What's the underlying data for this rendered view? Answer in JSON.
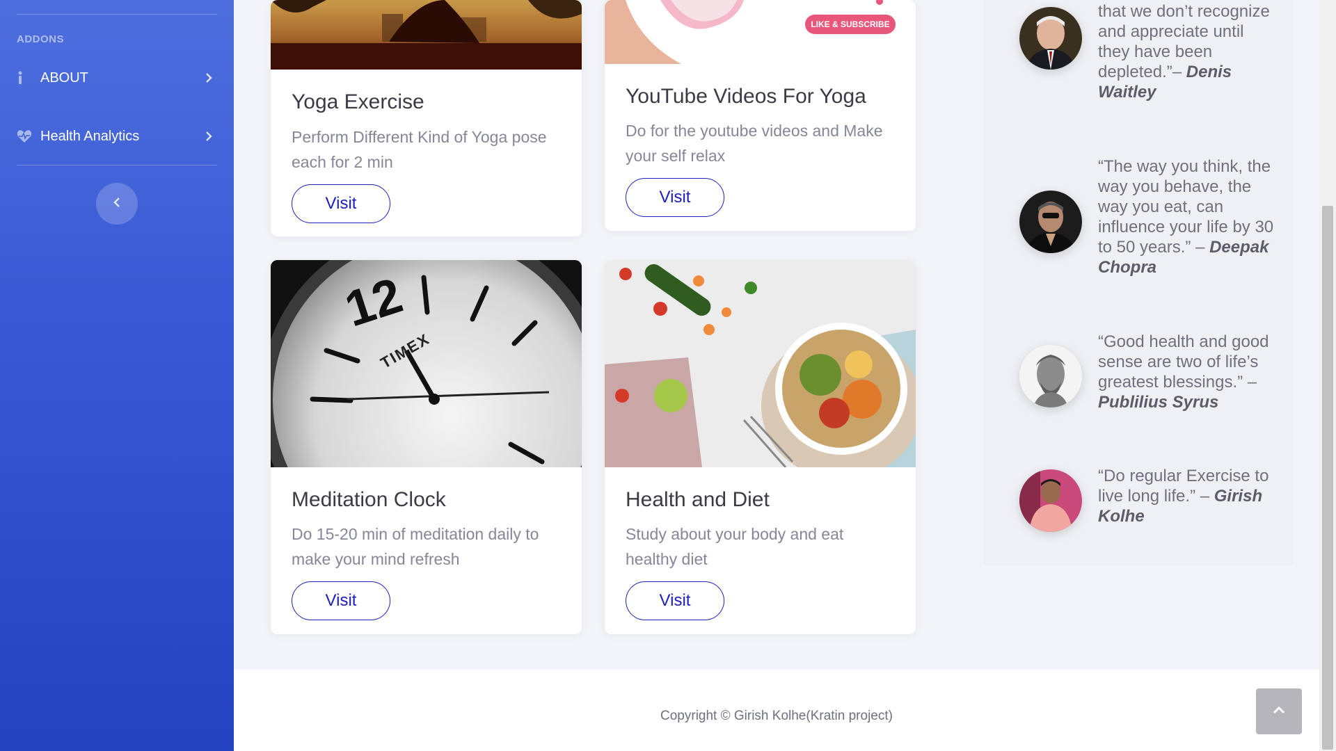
{
  "sidebar": {
    "heading": "ADDONS",
    "items": [
      {
        "label": "ABOUT",
        "icon": "info-icon"
      },
      {
        "label": "Health Analytics",
        "icon": "heartbeat-icon"
      }
    ],
    "toggle_icon": "chevron-left-icon"
  },
  "cards": [
    {
      "title": "Yoga Exercise",
      "text": "Perform Different Kind of Yoga pose each for 2 min",
      "button": "Visit"
    },
    {
      "title": "YouTube Videos For Yoga",
      "text": "Do for the youtube videos and Make your self relax",
      "button": "Visit",
      "badge": "LIKE & SUBSCRIBE"
    },
    {
      "title": "Meditation Clock",
      "text": "Do 15-20 min of meditation daily to make your mind refresh",
      "button": "Visit",
      "clock_brand": "TIMEX",
      "clock_number": "12"
    },
    {
      "title": "Health and Diet",
      "text": "Study about your body and eat healthy diet",
      "button": "Visit"
    }
  ],
  "quotes": [
    {
      "text": "that we don’t recognize and appreciate until they have been depleted.”–",
      "author": "Denis Waitley"
    },
    {
      "text": "“The way you think, the way you behave, the way you eat, can influence your life by 30 to 50 years.” –",
      "author": "Deepak Chopra"
    },
    {
      "text": "“Good health and good sense are two of life’s greatest blessings.” –",
      "author": "Publilius Syrus"
    },
    {
      "text": "“Do regular Exercise to live long life.” –",
      "author": "Girish Kolhe"
    }
  ],
  "footer": {
    "copyright": "Copyright © Girish Kolhe(Kratin project)"
  },
  "colors": {
    "sidebar": "#3a5ad6",
    "button": "#1b1fbd",
    "accent_badge": "#e8567c"
  }
}
